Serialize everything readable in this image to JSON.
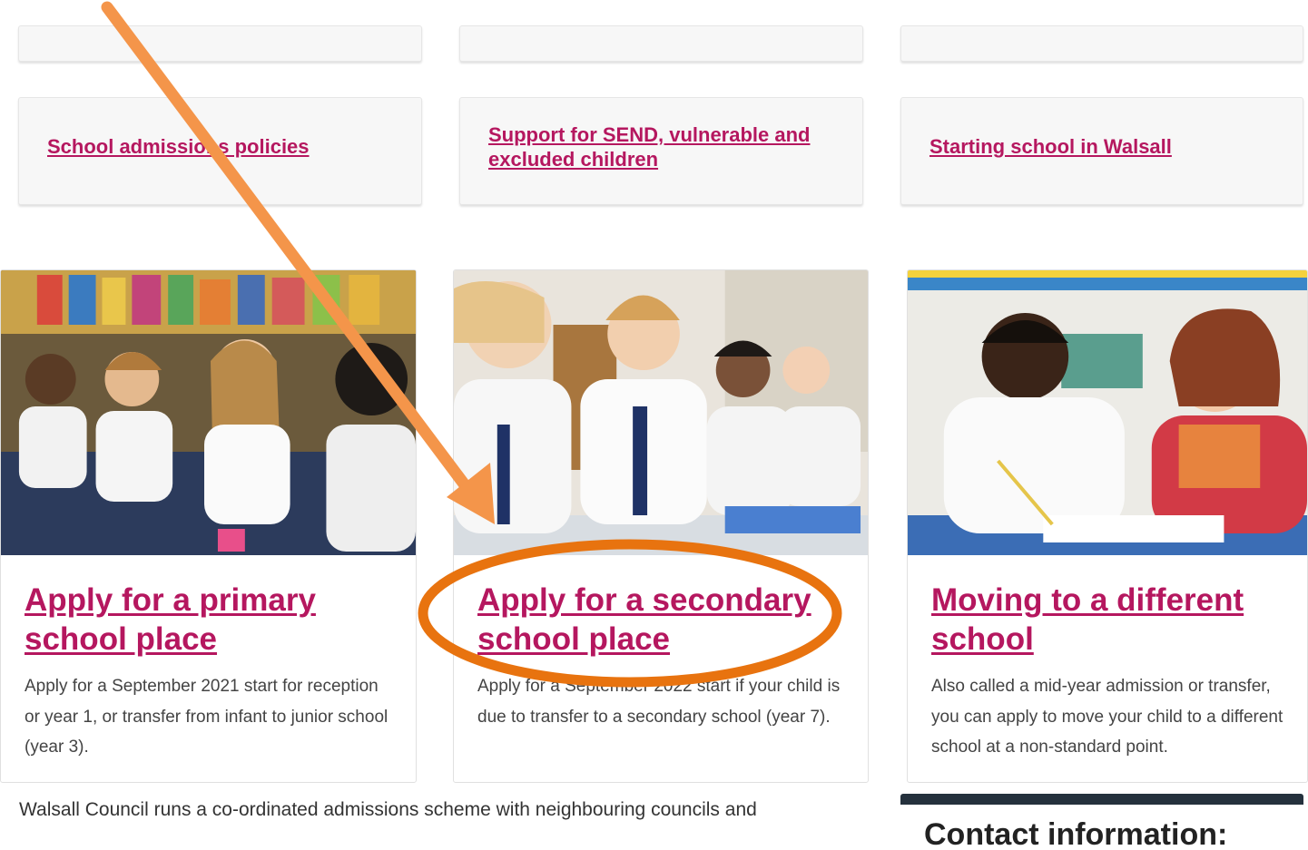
{
  "top_links": [
    {
      "label": "School admissions policies"
    },
    {
      "label": "Support for SEND, vulnerable and excluded children"
    },
    {
      "label": "Starting school in Walsall"
    }
  ],
  "cards": [
    {
      "title": "Apply for a primary school place",
      "description": "Apply for a September 2021 start for reception or year 1, or transfer from infant to junior school (year 3)."
    },
    {
      "title": "Apply for a secondary school place",
      "description": "Apply for a September 2022 start if your child is due to transfer to a secondary school (year 7)."
    },
    {
      "title": "Moving to a different school",
      "description": "Also called a mid-year admission or transfer, you can apply to move your child to a different school at a non-standard point."
    }
  ],
  "body_text": "Walsall Council runs a co-ordinated admissions scheme with neighbouring councils and",
  "contact": {
    "heading": "Contact information:"
  },
  "colors": {
    "link": "#b5175f",
    "arrow": "#f4954a",
    "circle": "#e8730f"
  }
}
